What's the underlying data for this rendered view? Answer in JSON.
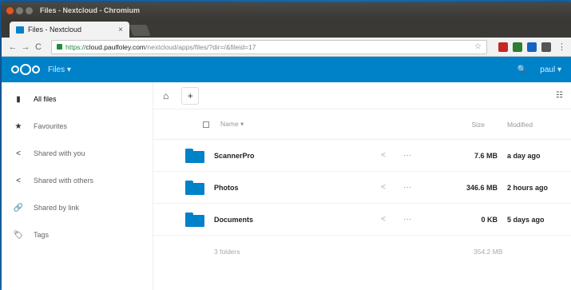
{
  "window": {
    "title": "Files - Nextcloud - Chromium"
  },
  "tab": {
    "title": "Files - Nextcloud",
    "close": "×"
  },
  "address": {
    "back": "←",
    "forward": "→",
    "reload": "C",
    "secure": "https://",
    "host": "cloud.paulfoley.com",
    "path": "/nextcloud/apps/files/?dir=/&fileid=17",
    "star": "☆"
  },
  "header": {
    "app_name": "Files ▾",
    "user": "paul ▾",
    "search": "🔍"
  },
  "sidebar": {
    "items": [
      {
        "label": "All files",
        "icon": "▮"
      },
      {
        "label": "Favourites",
        "icon": "★"
      },
      {
        "label": "Shared with you",
        "icon": "<"
      },
      {
        "label": "Shared with others",
        "icon": "<"
      },
      {
        "label": "Shared by link",
        "icon": "🔗"
      },
      {
        "label": "Tags",
        "icon": "🏷"
      }
    ]
  },
  "toolbar": {
    "add": "+"
  },
  "table": {
    "col_name": "Name ▾",
    "col_size": "Size",
    "col_modified": "Modified",
    "rows": [
      {
        "name": "ScannerPro",
        "size": "7.6 MB",
        "modified": "a day ago"
      },
      {
        "name": "Photos",
        "size": "346.6 MB",
        "modified": "2 hours ago"
      },
      {
        "name": "Documents",
        "size": "0 KB",
        "modified": "5 days ago"
      }
    ],
    "summary_count": "3 folders",
    "summary_size": "354.2 MB"
  }
}
